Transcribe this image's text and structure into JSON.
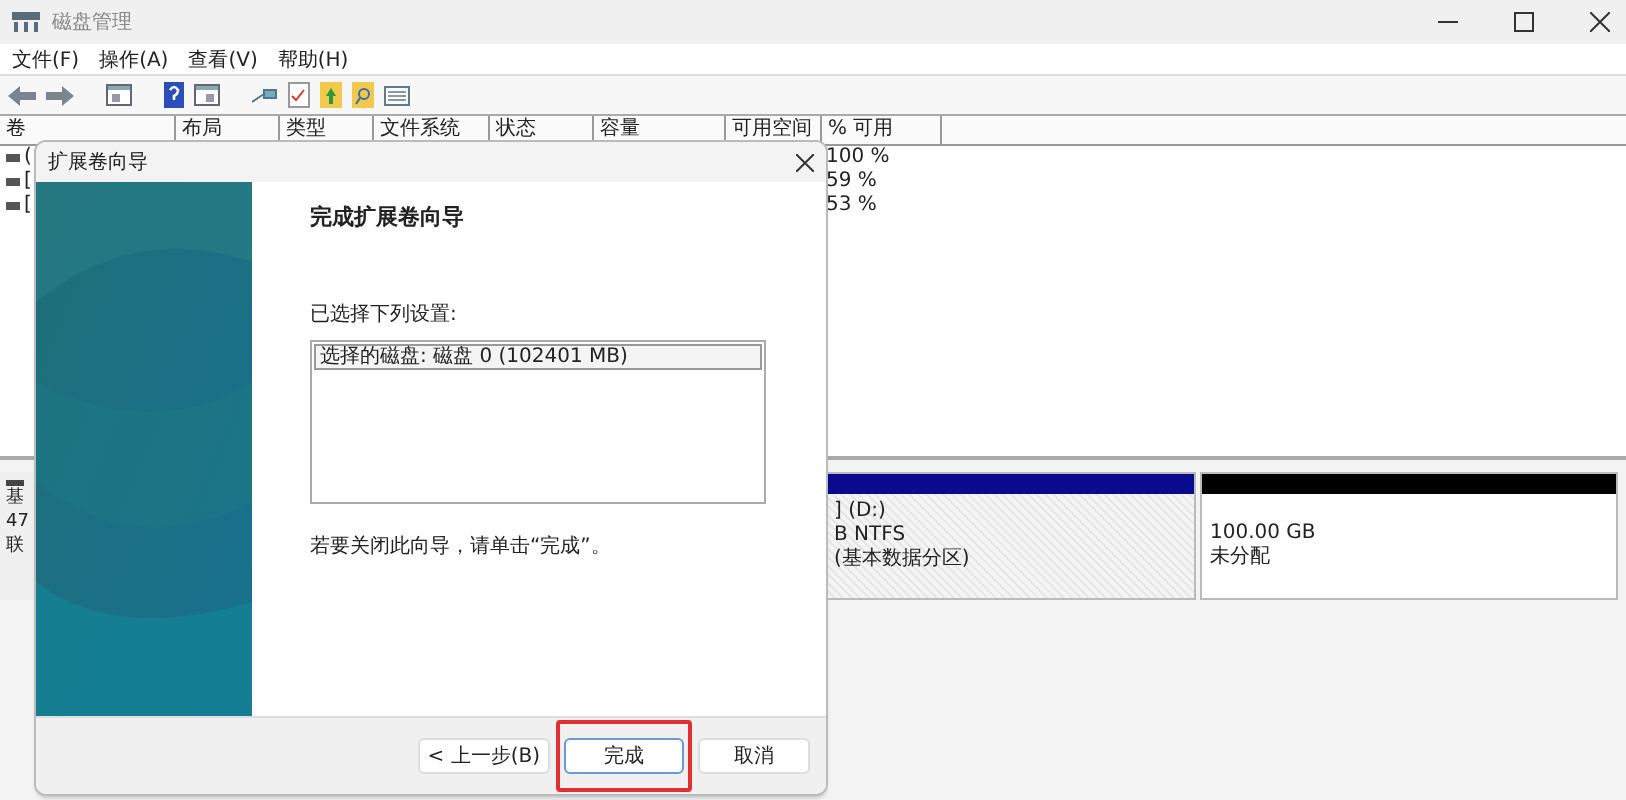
{
  "window": {
    "title": "磁盘管理"
  },
  "menu": [
    "文件(F)",
    "操作(A)",
    "查看(V)",
    "帮助(H)"
  ],
  "table": {
    "columns": [
      "卷",
      "布局",
      "类型",
      "文件系统",
      "状态",
      "容量",
      "可用空间",
      "% 可用"
    ],
    "rows": [
      {
        "volume": "(",
        "percent_free": "100 %"
      },
      {
        "volume": "[",
        "percent_free": "59 %"
      },
      {
        "volume": "[",
        "percent_free": "53 %"
      }
    ]
  },
  "disk": {
    "label_lines": [
      "基",
      "47",
      "联"
    ],
    "partitions": [
      {
        "kind": "primary",
        "lines": [
          "] (D:)",
          "B NTFS",
          "(基本数据分区)"
        ]
      },
      {
        "kind": "unallocated",
        "lines": [
          "100.00 GB",
          "未分配"
        ]
      }
    ]
  },
  "dialog": {
    "title": "扩展卷向导",
    "heading": "完成扩展卷向导",
    "list_label": "已选择下列设置:",
    "settings": [
      {
        "text": "选择的磁盘: 磁盘 0 (102401 MB)",
        "selected": true
      }
    ],
    "closing_note": "若要关闭此向导，请单击“完成”。",
    "buttons": [
      {
        "label": "< 上一步(B)",
        "highlighted": false
      },
      {
        "label": "完成",
        "highlighted": true
      },
      {
        "label": "取消",
        "highlighted": false
      }
    ]
  }
}
